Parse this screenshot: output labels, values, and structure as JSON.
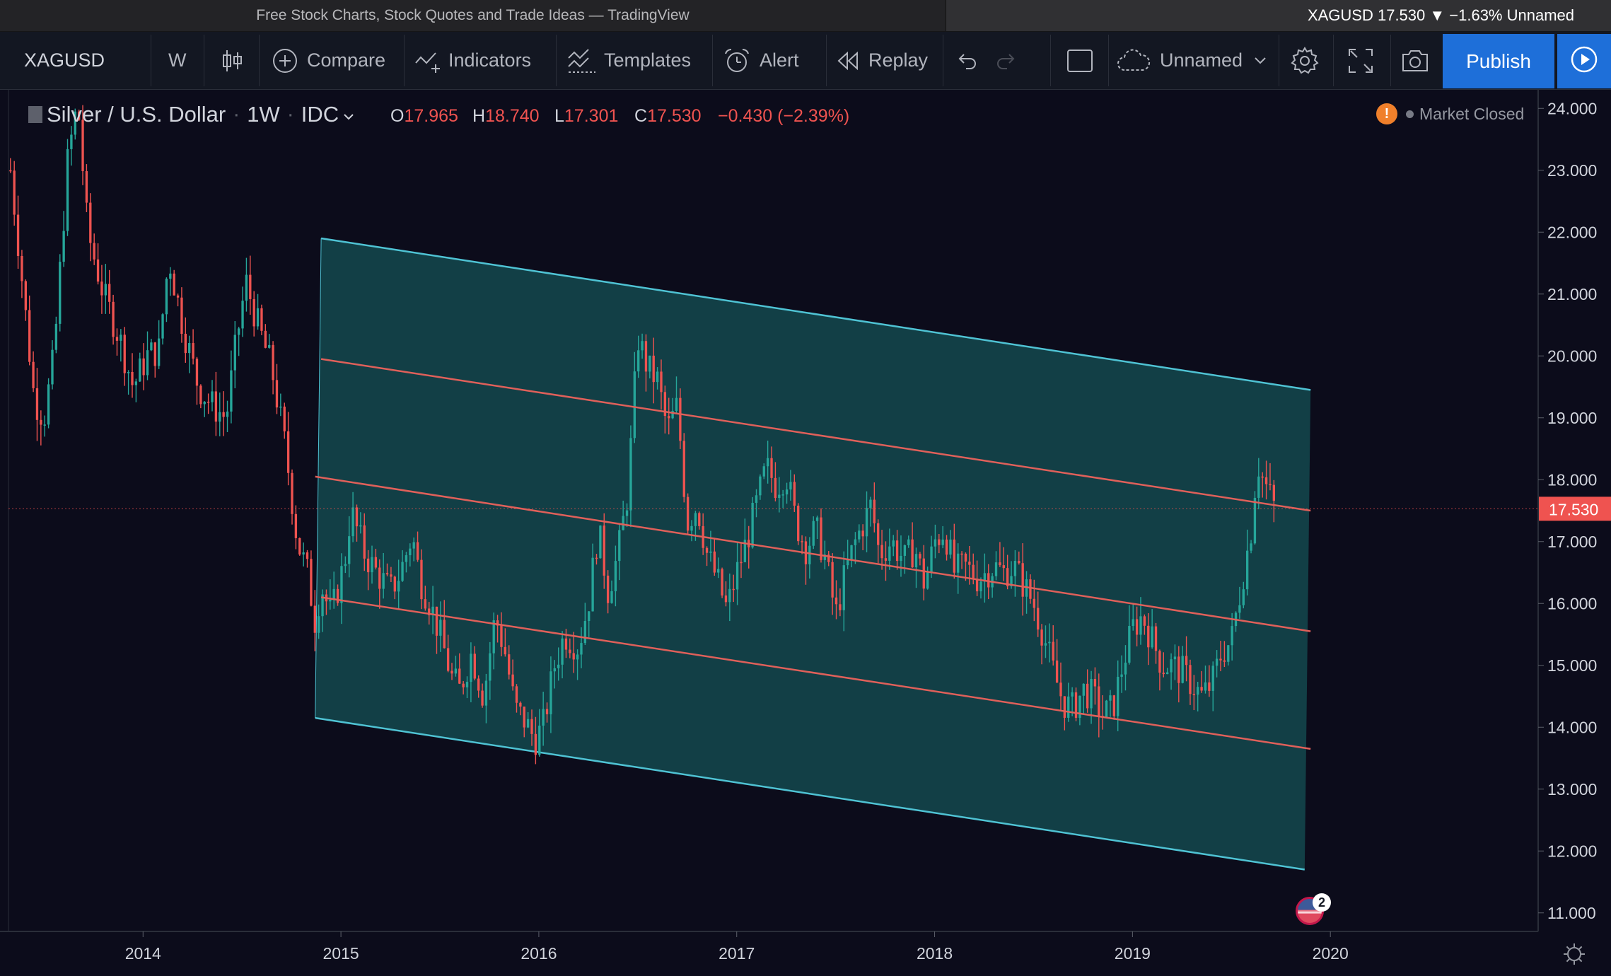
{
  "browser": {
    "tab_title": "Free Stock Charts, Stock Quotes and Trade Ideas — TradingView",
    "ticker_tab": "XAGUSD 17.530 ▼ −1.63% Unnamed"
  },
  "toolbar": {
    "symbol": "XAGUSD",
    "interval": "W",
    "compare_label": "Compare",
    "indicators_label": "Indicators",
    "templates_label": "Templates",
    "alert_label": "Alert",
    "replay_label": "Replay",
    "layout_label": "Unnamed",
    "publish_label": "Publish"
  },
  "legend": {
    "symbol_name": "Silver / U.S. Dollar",
    "interval": "1W",
    "source": "IDC",
    "open_key": "O",
    "open": "17.965",
    "high_key": "H",
    "high": "18.740",
    "low_key": "L",
    "low": "17.301",
    "close_key": "C",
    "close": "17.530",
    "change": "−0.430 (−2.39%)",
    "status": "Market Closed",
    "warning_icon": "!"
  },
  "events": {
    "badge_count": "2"
  },
  "colors": {
    "background": "#0c0c1b",
    "up": "#26a69a",
    "down": "#ef5350",
    "channel_line": "#4fc3d4",
    "channel_fill": "#14494d",
    "median_lines": "#e0605a",
    "accent": "#1e6fd9"
  },
  "chart_data": {
    "type": "candlestick",
    "symbol": "XAGUSD",
    "interval": "1W",
    "last_price": 17.53,
    "ylim": [
      10.7,
      24.3
    ],
    "xlim": [
      2013.32,
      2021.05
    ],
    "y_ticks": [
      "11.000",
      "12.000",
      "13.000",
      "14.000",
      "15.000",
      "16.000",
      "17.000",
      "18.000",
      "19.000",
      "20.000",
      "21.000",
      "22.000",
      "23.000",
      "24.000"
    ],
    "x_ticks": [
      {
        "label": "2014",
        "x": 2014.0
      },
      {
        "label": "2015",
        "x": 2015.0
      },
      {
        "label": "2016",
        "x": 2016.0
      },
      {
        "label": "2017",
        "x": 2017.0
      },
      {
        "label": "2018",
        "x": 2018.0
      },
      {
        "label": "2019",
        "x": 2019.0
      },
      {
        "label": "2020",
        "x": 2020.0
      }
    ],
    "last_price_label": "17.530",
    "price_path": [
      [
        2013.33,
        23.0
      ],
      [
        2013.38,
        21.5
      ],
      [
        2013.45,
        19.3
      ],
      [
        2013.5,
        19.0
      ],
      [
        2013.55,
        20.0
      ],
      [
        2013.62,
        23.2
      ],
      [
        2013.67,
        24.1
      ],
      [
        2013.72,
        22.0
      ],
      [
        2013.8,
        21.0
      ],
      [
        2013.88,
        20.3
      ],
      [
        2013.95,
        19.5
      ],
      [
        2014.02,
        20.0
      ],
      [
        2014.08,
        20.1
      ],
      [
        2014.13,
        21.6
      ],
      [
        2014.2,
        20.5
      ],
      [
        2014.28,
        19.5
      ],
      [
        2014.35,
        19.2
      ],
      [
        2014.42,
        19.0
      ],
      [
        2014.47,
        20.2
      ],
      [
        2014.52,
        21.2
      ],
      [
        2014.58,
        20.5
      ],
      [
        2014.65,
        19.8
      ],
      [
        2014.72,
        18.5
      ],
      [
        2014.78,
        17.0
      ],
      [
        2014.83,
        16.5
      ],
      [
        2014.87,
        15.7
      ],
      [
        2014.9,
        16.3
      ],
      [
        2014.95,
        15.8
      ],
      [
        2015.02,
        16.7
      ],
      [
        2015.05,
        17.5
      ],
      [
        2015.12,
        16.8
      ],
      [
        2015.18,
        16.5
      ],
      [
        2015.25,
        16.2
      ],
      [
        2015.3,
        16.5
      ],
      [
        2015.36,
        17.1
      ],
      [
        2015.4,
        16.4
      ],
      [
        2015.45,
        16.0
      ],
      [
        2015.5,
        15.5
      ],
      [
        2015.56,
        14.8
      ],
      [
        2015.6,
        14.6
      ],
      [
        2015.66,
        15.2
      ],
      [
        2015.72,
        14.5
      ],
      [
        2015.78,
        15.8
      ],
      [
        2015.83,
        15.2
      ],
      [
        2015.88,
        14.3
      ],
      [
        2015.93,
        14.1
      ],
      [
        2015.98,
        13.8
      ],
      [
        2016.02,
        14.0
      ],
      [
        2016.08,
        15.0
      ],
      [
        2016.13,
        15.5
      ],
      [
        2016.2,
        15.3
      ],
      [
        2016.25,
        16.0
      ],
      [
        2016.3,
        17.2
      ],
      [
        2016.35,
        16.2
      ],
      [
        2016.4,
        16.8
      ],
      [
        2016.45,
        17.8
      ],
      [
        2016.5,
        20.3
      ],
      [
        2016.55,
        19.8
      ],
      [
        2016.6,
        19.6
      ],
      [
        2016.65,
        18.8
      ],
      [
        2016.7,
        19.2
      ],
      [
        2016.75,
        17.3
      ],
      [
        2016.8,
        17.6
      ],
      [
        2016.85,
        16.8
      ],
      [
        2016.9,
        16.4
      ],
      [
        2016.95,
        15.9
      ],
      [
        2017.0,
        16.5
      ],
      [
        2017.05,
        17.0
      ],
      [
        2017.1,
        17.6
      ],
      [
        2017.15,
        18.2
      ],
      [
        2017.2,
        17.9
      ],
      [
        2017.25,
        18.1
      ],
      [
        2017.3,
        17.3
      ],
      [
        2017.35,
        16.9
      ],
      [
        2017.4,
        17.2
      ],
      [
        2017.45,
        16.7
      ],
      [
        2017.5,
        15.8
      ],
      [
        2017.55,
        16.5
      ],
      [
        2017.6,
        17.0
      ],
      [
        2017.68,
        17.6
      ],
      [
        2017.72,
        16.8
      ],
      [
        2017.78,
        17.0
      ],
      [
        2017.85,
        16.7
      ],
      [
        2017.9,
        16.9
      ],
      [
        2017.95,
        16.3
      ],
      [
        2018.0,
        17.0
      ],
      [
        2018.05,
        17.2
      ],
      [
        2018.1,
        16.5
      ],
      [
        2018.15,
        16.6
      ],
      [
        2018.22,
        16.4
      ],
      [
        2018.3,
        16.6
      ],
      [
        2018.35,
        16.5
      ],
      [
        2018.4,
        16.6
      ],
      [
        2018.45,
        16.3
      ],
      [
        2018.5,
        16.0
      ],
      [
        2018.55,
        15.5
      ],
      [
        2018.6,
        14.9
      ],
      [
        2018.65,
        14.4
      ],
      [
        2018.7,
        14.3
      ],
      [
        2018.75,
        14.6
      ],
      [
        2018.8,
        14.5
      ],
      [
        2018.85,
        14.2
      ],
      [
        2018.9,
        14.3
      ],
      [
        2018.95,
        15.0
      ],
      [
        2019.0,
        15.6
      ],
      [
        2019.05,
        15.8
      ],
      [
        2019.1,
        15.4
      ],
      [
        2019.15,
        15.0
      ],
      [
        2019.2,
        15.0
      ],
      [
        2019.25,
        14.9
      ],
      [
        2019.3,
        14.7
      ],
      [
        2019.35,
        14.5
      ],
      [
        2019.4,
        14.7
      ],
      [
        2019.45,
        15.2
      ],
      [
        2019.5,
        15.4
      ],
      [
        2019.55,
        16.3
      ],
      [
        2019.6,
        17.2
      ],
      [
        2019.63,
        18.3
      ],
      [
        2019.66,
        18.0
      ],
      [
        2019.7,
        17.7
      ],
      [
        2019.72,
        17.53
      ]
    ],
    "drawings": {
      "parallel_channel": {
        "upper": [
          [
            2014.9,
            21.9
          ],
          [
            2019.9,
            19.45
          ]
        ],
        "lower": [
          [
            2014.87,
            14.15
          ],
          [
            2019.87,
            11.7
          ]
        ]
      },
      "lines": [
        [
          [
            2014.9,
            19.95
          ],
          [
            2019.9,
            17.5
          ]
        ],
        [
          [
            2014.87,
            18.05
          ],
          [
            2019.9,
            15.55
          ]
        ],
        [
          [
            2014.9,
            16.1
          ],
          [
            2019.9,
            13.65
          ]
        ]
      ]
    }
  }
}
